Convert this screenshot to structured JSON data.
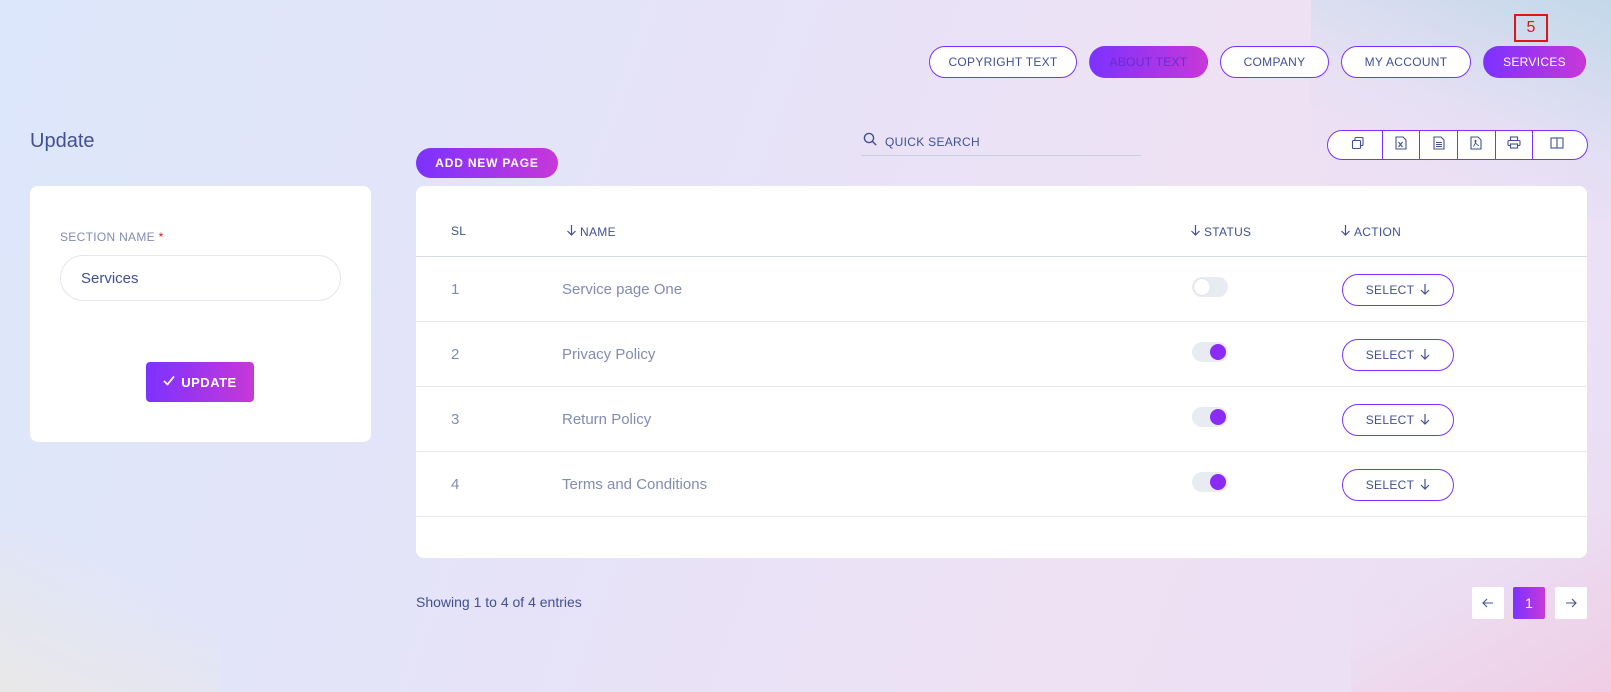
{
  "colors": {
    "accent_start": "#7c32ff",
    "accent_end": "#c738d8",
    "text": "#415094",
    "muted_text": "#828bb2",
    "required": "#e01515"
  },
  "top_nav": {
    "items": [
      {
        "label": "COPYRIGHT TEXT",
        "state": "default"
      },
      {
        "label": "ABOUT TEXT",
        "state": "highlighted"
      },
      {
        "label": "COMPANY",
        "state": "default"
      },
      {
        "label": "MY ACCOUNT",
        "state": "default"
      },
      {
        "label": "SERVICES",
        "state": "active"
      }
    ],
    "marker_label": "5"
  },
  "form": {
    "title": "Update",
    "field_label": "SECTION NAME",
    "required_mark": "*",
    "field_value": "Services",
    "submit_label": "UPDATE",
    "submit_icon": "check-icon"
  },
  "toolbar": {
    "add_label": "ADD NEW PAGE",
    "search_placeholder": "QUICK SEARCH",
    "search_icon": "search-icon",
    "tools": [
      "copy-icon",
      "excel-icon",
      "csv-icon",
      "pdf-icon",
      "print-icon",
      "columns-icon"
    ]
  },
  "table": {
    "columns": [
      {
        "label": "SL",
        "sort": false
      },
      {
        "label": "NAME",
        "sort": true
      },
      {
        "label": "STATUS",
        "sort": true
      },
      {
        "label": "ACTION",
        "sort": true
      }
    ],
    "rows": [
      {
        "sl": "1",
        "name": "Service page One",
        "status_on": false,
        "action": "SELECT"
      },
      {
        "sl": "2",
        "name": "Privacy Policy",
        "status_on": true,
        "action": "SELECT"
      },
      {
        "sl": "3",
        "name": "Return Policy",
        "status_on": true,
        "action": "SELECT"
      },
      {
        "sl": "4",
        "name": "Terms and Conditions",
        "status_on": true,
        "action": "SELECT"
      }
    ]
  },
  "footer": {
    "showing_text": "Showing 1 to 4 of 4 entries",
    "current_page": "1",
    "prev_icon": "arrow-left-icon",
    "next_icon": "arrow-right-icon"
  }
}
